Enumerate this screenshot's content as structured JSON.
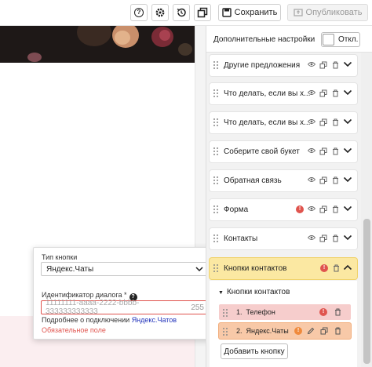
{
  "toolbar": {
    "help_icon": "?",
    "save_label": "Сохранить",
    "publish_label": "Опубликовать"
  },
  "popup": {
    "button_type_label": "Тип кнопки",
    "button_type_value": "Яндекс.Чаты",
    "dialog_id_label": "Идентификатор диалога *",
    "dialog_id_placeholder": "11111111-aaaa-2222-bbbb-333333333333",
    "char_count": "255",
    "hint_prefix": "Подробнее о подключении ",
    "hint_link": "Яндекс.Чатов",
    "error_text": "Обязательное поле"
  },
  "panel": {
    "title": "Дополнительные настройки",
    "toggle_label": "Откл.",
    "sections": [
      {
        "name": "Другие предложения"
      },
      {
        "name": "Что делать, если вы х..."
      },
      {
        "name": "Что делать, если вы х..."
      },
      {
        "name": "Соберите свой букет"
      },
      {
        "name": "Обратная связь"
      },
      {
        "name": "Форма",
        "error": true
      },
      {
        "name": "Контакты"
      }
    ],
    "active_section": "Кнопки контактов",
    "sub_title": "Кнопки контактов",
    "sub_items": [
      {
        "index": "1.",
        "name": "Телефон"
      },
      {
        "index": "2.",
        "name": "Яндекс.Чаты"
      }
    ],
    "add_button_label": "Добавить кнопку"
  },
  "colors": {
    "error": "#e0544e",
    "active_section": "#fbe8a2",
    "sub_item_1": "#f6cdcc",
    "sub_item_2": "#f8c9a8",
    "link": "#2233bb"
  }
}
